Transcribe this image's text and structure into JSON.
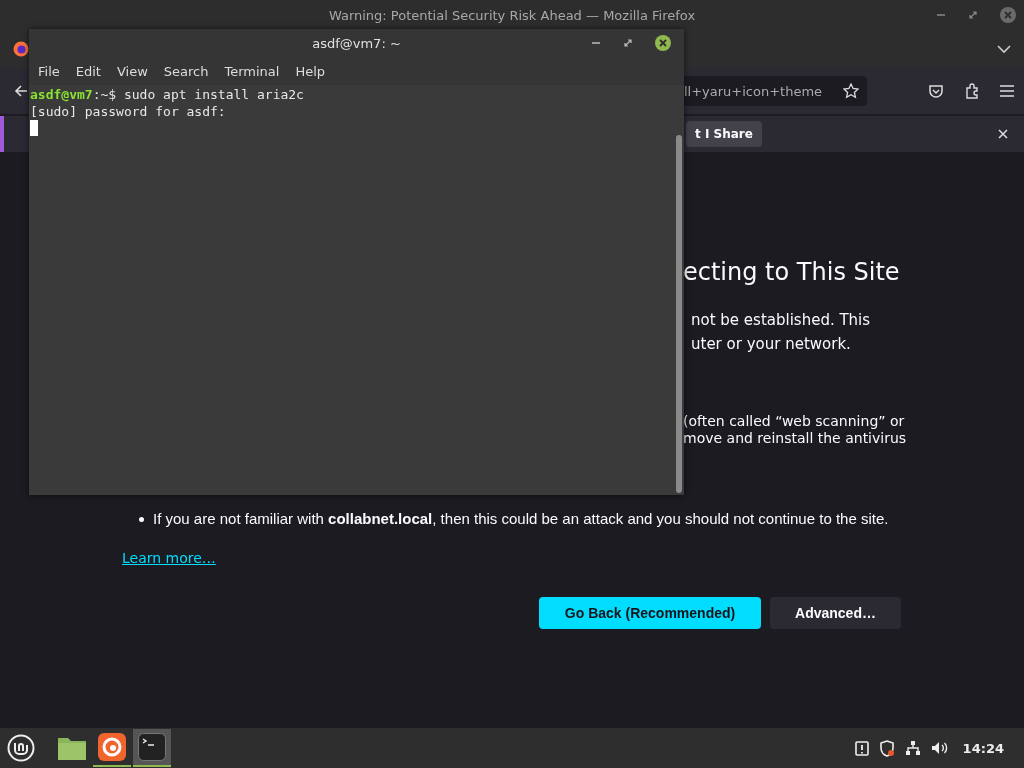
{
  "firefox": {
    "title": "Warning: Potential Security Risk Ahead — Mozilla Firefox",
    "url_fragment": "ll+yaru+icon+theme",
    "notification": {
      "button": "t I Share"
    },
    "page": {
      "heading_fragment": "ecting to This Site",
      "paragraph_fragments": [
        "not be established. This",
        "uter or your network."
      ],
      "note_fragments": [
        "(often called “web scanning” or",
        "move and reinstall the antivirus"
      ],
      "bullet": "If you are not familiar with **collabnet.local**, then this could be an attack and you should not continue to the site.",
      "learn_more": "Learn more…",
      "buttons": [
        {
          "label": "Go Back (Recommended)",
          "kind": "primary"
        },
        {
          "label": "Advanced…",
          "kind": "secondary"
        }
      ]
    }
  },
  "terminal": {
    "title": "asdf@vm7: ~",
    "menu": [
      "File",
      "Edit",
      "View",
      "Search",
      "Terminal",
      "Help"
    ],
    "lines": [
      {
        "prompt_user": "asdf@vm7",
        "text": ":~$ sudo apt install aria2c",
        "cursor": false
      },
      {
        "text": "[sudo] password for asdf:",
        "cursor": false
      },
      {
        "cursor": true
      }
    ]
  },
  "taskbar": {
    "apps": [
      {
        "kind": "files",
        "running": false,
        "selected": false
      },
      {
        "kind": "firefox",
        "running": true,
        "selected": false
      },
      {
        "kind": "terminal",
        "running": true,
        "selected": true
      }
    ],
    "clock": "14:24"
  }
}
